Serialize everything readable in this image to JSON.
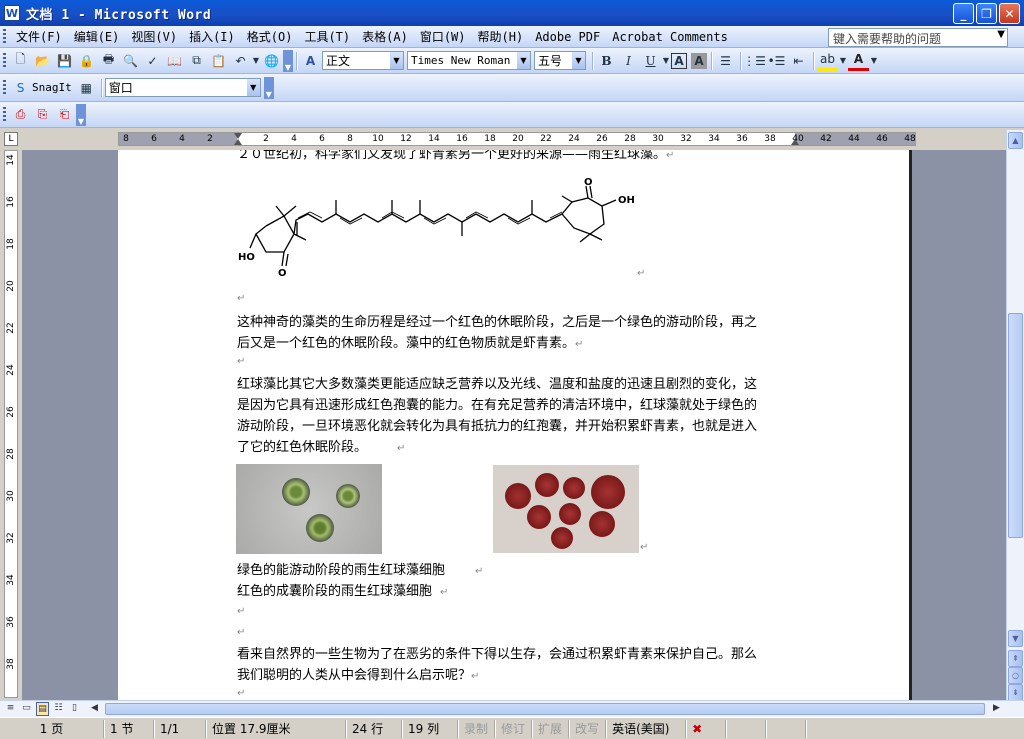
{
  "window": {
    "title": "文档 1 - Microsoft Word",
    "icon_letter": "W",
    "minimize": "_",
    "maximize": "❐",
    "close": "✕"
  },
  "menu": {
    "items": [
      "文件(F)",
      "编辑(E)",
      "视图(V)",
      "插入(I)",
      "格式(O)",
      "工具(T)",
      "表格(A)",
      "窗口(W)",
      "帮助(H)",
      "Adobe PDF",
      "Acrobat Comments"
    ],
    "help_placeholder": "键入需要帮助的问题"
  },
  "formatting": {
    "style": "正文",
    "font": "Times New Roman",
    "size": "五号",
    "bold": "B",
    "italic": "I",
    "underline": "U",
    "char_border": "A",
    "char_shading": "A"
  },
  "snagit": {
    "label": "SnagIt",
    "window_combo": "窗口"
  },
  "ruler": {
    "ticks": [
      "8",
      "6",
      "4",
      "2",
      "2",
      "4",
      "6",
      "8",
      "10",
      "12",
      "14",
      "16",
      "18",
      "20",
      "22",
      "24",
      "26",
      "28",
      "30",
      "32",
      "34",
      "36",
      "38",
      "40",
      "42",
      "44",
      "46",
      "48"
    ],
    "vticks": [
      "14",
      "16",
      "18",
      "20",
      "22",
      "24",
      "26",
      "28",
      "30",
      "32",
      "34",
      "36",
      "38"
    ],
    "tab_selector": "L"
  },
  "document": {
    "line_top": "２０世纪初，科学家们又发现了虾青素另一个更好的来源——雨生红球藻。",
    "molecule": {
      "ho_left": "HO",
      "o_left": "O",
      "o_right": "O",
      "oh_right": "OH"
    },
    "para1": [
      "这种神奇的藻类的生命历程是经过一个红色的休眠阶段，之后是一个绿色的游动阶段，再之",
      "后又是一个红色的休眠阶段。藻中的红色物质就是虾青素。"
    ],
    "para2": [
      "红球藻比其它大多数藻类更能适应缺乏营养以及光线、温度和盐度的迅速且剧烈的变化，这",
      "是因为它具有迅速形成红色孢囊的能力。在有充足营养的清洁环境中，红球藻就处于绿色的",
      "游动阶段，一旦环境恶化就会转化为具有抵抗力的红孢囊，并开始积累虾青素，也就是进入",
      "了它的红色休眠阶段。"
    ],
    "caption1": "绿色的能游动阶段的雨生红球藻细胞",
    "caption2": "红色的成囊阶段的雨生红球藻细胞",
    "para3": [
      "看来自然界的一些生物为了在恶劣的条件下得以生存，会通过积累虾青素来保护自己。那么",
      "我们聪明的人类从中会得到什么启示呢？"
    ],
    "para_mark": "↵"
  },
  "statusbar": {
    "page": "1 页",
    "section": "1 节",
    "page_of": "1/1",
    "position": "位置 17.9厘米",
    "line": "24 行",
    "column": "19 列",
    "rec": "录制",
    "trk": "修订",
    "ext": "扩展",
    "ovr": "改写",
    "language": "英语(美国)"
  }
}
